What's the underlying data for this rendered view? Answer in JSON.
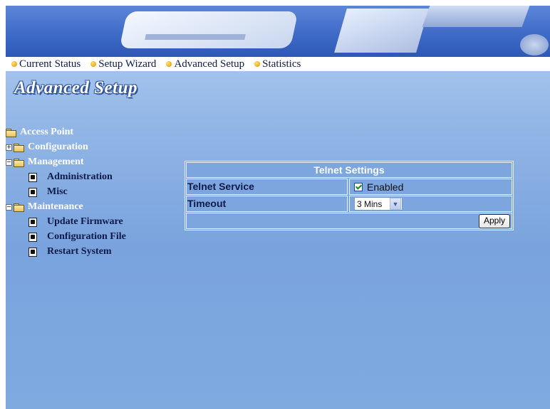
{
  "nav": [
    {
      "label": "Current Status"
    },
    {
      "label": "Setup Wizard"
    },
    {
      "label": "Advanced Setup"
    },
    {
      "label": "Statistics"
    }
  ],
  "page_title": "Advanced Setup",
  "tree": {
    "root": "Access Point",
    "configuration": "Configuration",
    "management": "Management",
    "administration": "Administration",
    "misc": "Misc",
    "maintenance": "Maintenance",
    "update_firmware": "Update Firmware",
    "configuration_file": "Configuration File",
    "restart_system": "Restart System",
    "expand_plus": "+",
    "expand_minus": "−"
  },
  "telnet": {
    "title": "Telnet Settings",
    "service_label": "Telnet Service",
    "enabled_label": "Enabled",
    "enabled_checked": true,
    "timeout_label": "Timeout",
    "timeout_value": "3 Mins",
    "apply_label": "Apply"
  },
  "icons": {
    "nav_bullet": "orange-dot-icon",
    "folder": "folder-icon",
    "page": "page-icon",
    "dropdown": "chevron-down-icon"
  },
  "colors": {
    "accent_text": "#0d1a4a",
    "banner": "#3f6bc8",
    "panel": "#7da6de"
  }
}
